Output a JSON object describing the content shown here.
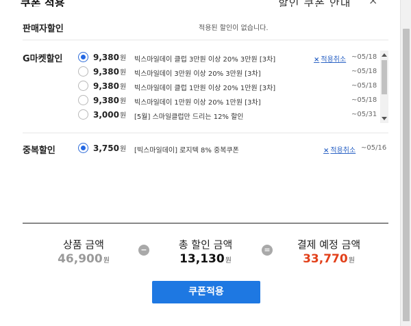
{
  "header": {
    "title_fragment": "쿠폰 적용",
    "right_fragment": "할인 쿠폰 안내",
    "close_glyph": "×"
  },
  "seller": {
    "title": "판매자할인",
    "message": "적용된 할인이 없습니다."
  },
  "gmarket": {
    "title": "G마켓할인",
    "items": [
      {
        "amount": "9,380",
        "unit": "원",
        "desc": "빅스마일데이 클럽 3만원 이상 20% 3만원 [3차]",
        "cancel": "적용취소",
        "date": "~05/18",
        "selected": true
      },
      {
        "amount": "9,380",
        "unit": "원",
        "desc": "빅스마일데이 3만원 이상 20% 3만원 [3차]",
        "cancel": "",
        "date": "~05/18",
        "selected": false
      },
      {
        "amount": "9,380",
        "unit": "원",
        "desc": "빅스마일데이 클럽 1만원 이상 20% 1만원 [3차]",
        "cancel": "",
        "date": "~05/18",
        "selected": false
      },
      {
        "amount": "9,380",
        "unit": "원",
        "desc": "빅스마일데이 1만원 이상 20% 1만원 [3차]",
        "cancel": "",
        "date": "~05/18",
        "selected": false
      },
      {
        "amount": "3,000",
        "unit": "원",
        "desc": "[5월] 스마일클럽만 드리는 12% 할인",
        "cancel": "",
        "date": "~05/31",
        "selected": false
      }
    ]
  },
  "duplicate": {
    "title": "중복할인",
    "items": [
      {
        "amount": "3,750",
        "unit": "원",
        "desc": "[빅스마일데이] 로지텍 8% 중복쿠폰",
        "cancel": "적용취소",
        "date": "~05/16",
        "selected": true
      }
    ]
  },
  "summary": {
    "product_label": "상품 금액",
    "product_value": "46,900",
    "discount_label": "총 할인 금액",
    "discount_value": "13,130",
    "payment_label": "결제 예정 금액",
    "payment_value": "33,770",
    "unit": "원",
    "minus_glyph": "−",
    "equals_glyph": "=",
    "colors": {
      "product": "#9a9a9a",
      "discount": "#111111",
      "payment": "#e2401a"
    }
  },
  "apply_button": {
    "label": "쿠폰적용",
    "color": "#1e78e2"
  },
  "cancel_x": "×"
}
